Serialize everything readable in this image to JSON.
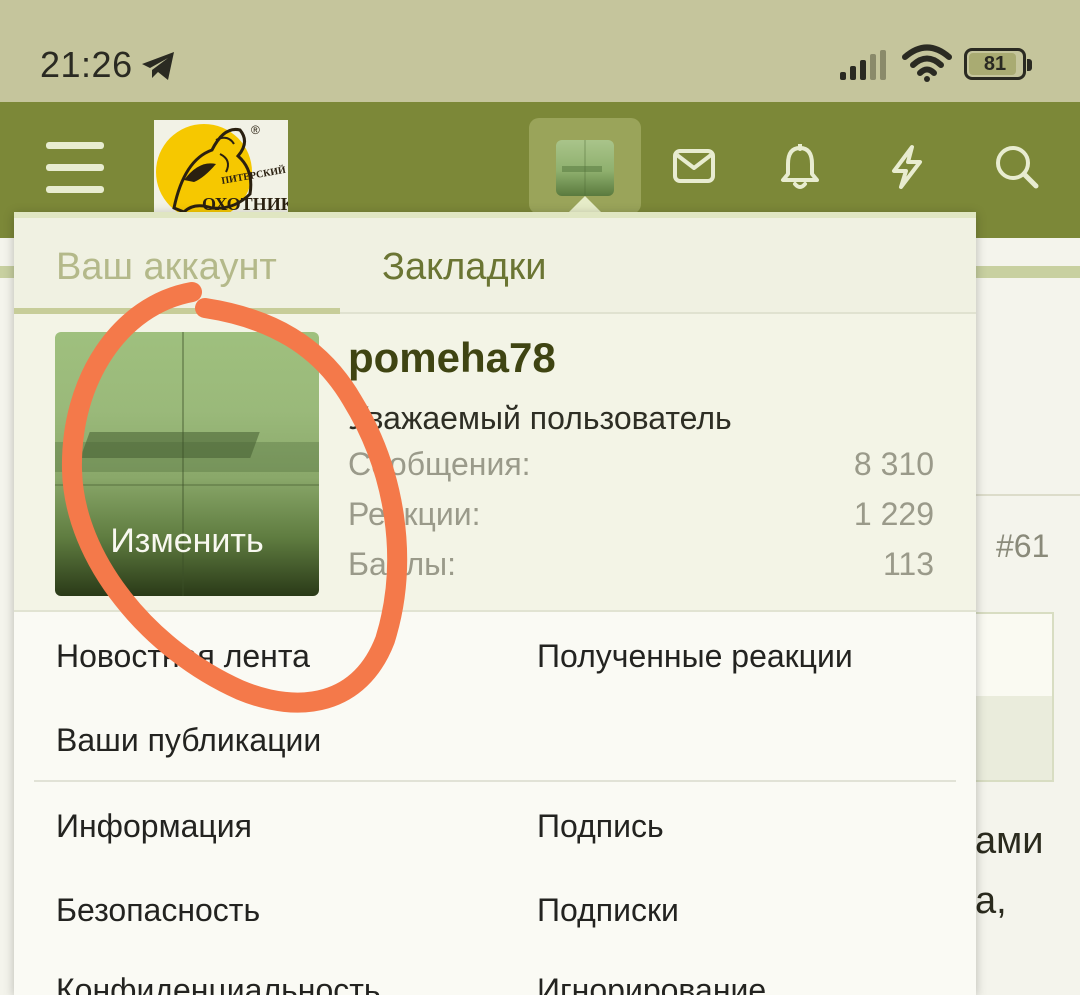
{
  "status_bar": {
    "time": "21:26",
    "battery": "81",
    "icons": [
      "telegram-icon",
      "signal-icon",
      "wifi-icon",
      "battery-icon"
    ]
  },
  "app_bar": {
    "logo_text_line1": "ПИТЕРСКИЙ",
    "logo_text_line2": "ОХОТНИК",
    "logo_mark": "®",
    "icons": [
      "menu-icon",
      "avatar",
      "mail-icon",
      "bell-icon",
      "lightning-icon",
      "search-icon"
    ],
    "colors": {
      "bar": "#7c8838",
      "status": "#c5c59c"
    }
  },
  "dropdown": {
    "tabs": [
      {
        "label": "Ваш аккаунт",
        "active": true
      },
      {
        "label": "Закладки",
        "active": false
      }
    ],
    "profile": {
      "edit_label": "Изменить",
      "username": "pomeha78",
      "user_title": "Уважаемый пользователь",
      "stats": [
        {
          "label": "Сообщения:",
          "value": "8 310"
        },
        {
          "label": "Реакции:",
          "value": "1 229"
        },
        {
          "label": "Баллы:",
          "value": "113"
        }
      ]
    },
    "menu": {
      "news_feed": "Новостная лента",
      "received_reactions": "Полученные реакции",
      "your_posts": "Ваши публикации",
      "info": "Информация",
      "signature": "Подпись",
      "security": "Безопасность",
      "subscriptions": "Подписки",
      "privacy": "Конфиденциальность",
      "ignoring": "Игнорирование"
    }
  },
  "background_page": {
    "post_number": "#61",
    "fragment_1": "ами",
    "fragment_2": "а,"
  },
  "annotation": {
    "scribble_color": "#f4794a"
  }
}
